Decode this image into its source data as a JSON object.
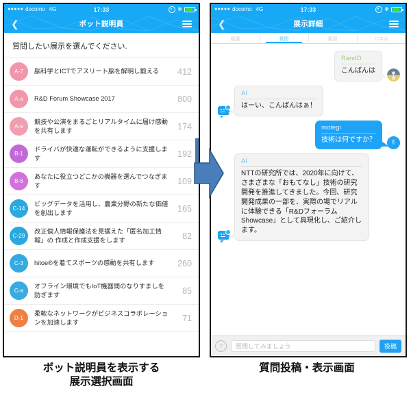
{
  "status_bar": {
    "signal_dots": "●●●●●",
    "carrier": "docomo",
    "network": "4G",
    "time": "17:33",
    "bluetooth_icon": "bluetooth-icon",
    "location_icon": "location-icon",
    "battery_icon": "battery-icon"
  },
  "left_screen": {
    "nav": {
      "back_icon": "chevron-left-icon",
      "title": "ボット説明員",
      "menu_icon": "hamburger-menu-icon"
    },
    "prompt": "質問したい展示を選んでください.",
    "rows": [
      {
        "code": "A-7",
        "color": "#f196ab",
        "text": "脳科学とICTでアスリート脳を解明し鍛える",
        "count": "412"
      },
      {
        "code": "A-a",
        "color": "#f196ab",
        "text": "R&D Forum Showcase 2017",
        "count": "800"
      },
      {
        "code": "A-e",
        "color": "#f09eb0",
        "text": "競技や公演をまるごとリアルタイムに届け感動を共有します",
        "count": "174"
      },
      {
        "code": "B-1",
        "color": "#c169d8",
        "text": "ドライバが快適な運転ができるように支援します",
        "count": "192"
      },
      {
        "code": "B-6",
        "color": "#d470dd",
        "text": "あなたに役立つどこかの機器を選んでつなぎます",
        "count": "109"
      },
      {
        "code": "C-14",
        "color": "#2aa9e0",
        "text": "ビッグデータを活用し、農業分野の新たな価値を創出します",
        "count": "165"
      },
      {
        "code": "C-29",
        "color": "#29a8e0",
        "text": "改正個人情報保護法を見据えた「匿名加工情報」の 作成と作成支援をします",
        "count": "82"
      },
      {
        "code": "C-3",
        "color": "#35a9e2",
        "text": "hitoe®を着てスポーツの感動を共有します",
        "count": "260"
      },
      {
        "code": "C-a",
        "color": "#3aaae2",
        "text": "オフライン環境でもIoT機器間のなりすましを防ぎます",
        "count": "85"
      },
      {
        "code": "D-1",
        "color": "#ef8044",
        "text": "柔軟なネットワークがビジネスコラボレーションを加速します",
        "count": "71"
      }
    ],
    "caption": "ボット説明員を表示する\n展示選択画面"
  },
  "right_screen": {
    "nav": {
      "back_icon": "chevron-left-icon",
      "title": "展示詳細",
      "menu_icon": "hamburger-menu-icon"
    },
    "tabs": [
      {
        "label": "概要",
        "active": false
      },
      {
        "label": "質問",
        "active": true
      },
      {
        "label": "相談",
        "active": false
      },
      {
        "label": "パネル",
        "active": false
      }
    ],
    "messages": [
      {
        "side": "right",
        "style": "gray",
        "name": "RandD",
        "name_color": "green",
        "body": "こんばんは",
        "icon": "user-avatar-icon"
      },
      {
        "side": "left",
        "style": "gray",
        "name": "AI",
        "name_color": "bluetx",
        "body": "はーい、こんばんはぁ！",
        "icon": "bot-icon"
      },
      {
        "side": "right",
        "style": "blue",
        "name": "motegi",
        "name_color": "white",
        "body": "技術は何ですか？",
        "icon": "hand-icon"
      },
      {
        "side": "left",
        "style": "gray",
        "name": "AI",
        "name_color": "bluetx",
        "body": "NTTの研究所では、2020年に向けて、さまざまな「おもてなし」技術の研究開発を推進してきました。今回、研究開発成果の一部を、実際の場でリアルに体験できる「R&DフォーラムShowcase」として具現化し、ご紹介します。",
        "icon": "bot-icon"
      }
    ],
    "input": {
      "help_icon": "question-mark-icon",
      "placeholder": "質問してみましょう",
      "value": "",
      "post_label": "投稿"
    },
    "caption": "質問投稿・表示画面"
  },
  "arrow": {
    "icon": "right-arrow-icon",
    "color": "#4a7ebb"
  },
  "theme": {
    "accent": "#17a9f5",
    "bubble_blue": "#1fa3f6",
    "bubble_gray": "#f3f3f3"
  }
}
